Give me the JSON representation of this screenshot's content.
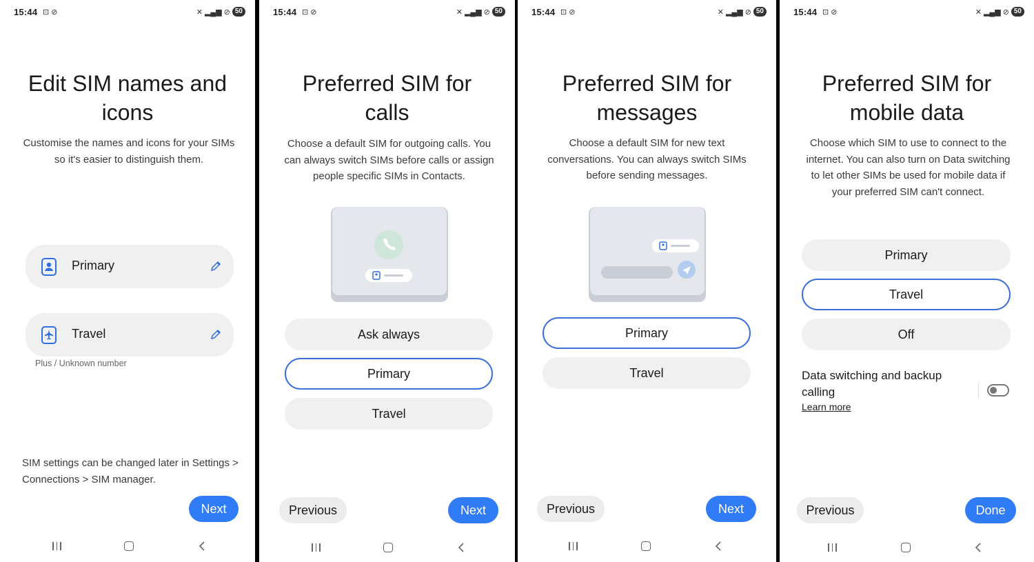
{
  "status": {
    "time": "15:44",
    "battery": "50"
  },
  "screen1": {
    "title": "Edit SIM names and icons",
    "description": "Customise the names and icons for your SIMs so it's easier to distinguish them.",
    "sims": [
      {
        "name": "Primary"
      },
      {
        "name": "Travel",
        "number": "Plus / Unknown number"
      }
    ],
    "note": "SIM settings can be changed later in Settings > Connections > SIM manager.",
    "next": "Next"
  },
  "screen2": {
    "title": "Preferred SIM for calls",
    "description": "Choose a default SIM for outgoing calls. You can always switch SIMs before calls or assign people specific SIMs in Contacts.",
    "options": [
      "Ask always",
      "Primary",
      "Travel"
    ],
    "selected": "Primary",
    "previous": "Previous",
    "next": "Next"
  },
  "screen3": {
    "title": "Preferred SIM for messages",
    "description": "Choose a default SIM for new text conversations. You can always switch SIMs before sending messages.",
    "options": [
      "Primary",
      "Travel"
    ],
    "selected": "Primary",
    "previous": "Previous",
    "next": "Next"
  },
  "screen4": {
    "title": "Preferred SIM for mobile data",
    "description": "Choose which SIM to use to connect to the internet. You can also turn on Data switching to let other SIMs be used for mobile data if your preferred SIM can't connect.",
    "options": [
      "Primary",
      "Travel",
      "Off"
    ],
    "selected": "Travel",
    "toggle_label": "Data switching and backup calling",
    "toggle_on": false,
    "learn_more": "Learn more",
    "previous": "Previous",
    "done": "Done"
  },
  "colors": {
    "accent": "#2f7cf6",
    "selected_border": "#3a6fd8",
    "option_bg": "#f0f0f0"
  }
}
